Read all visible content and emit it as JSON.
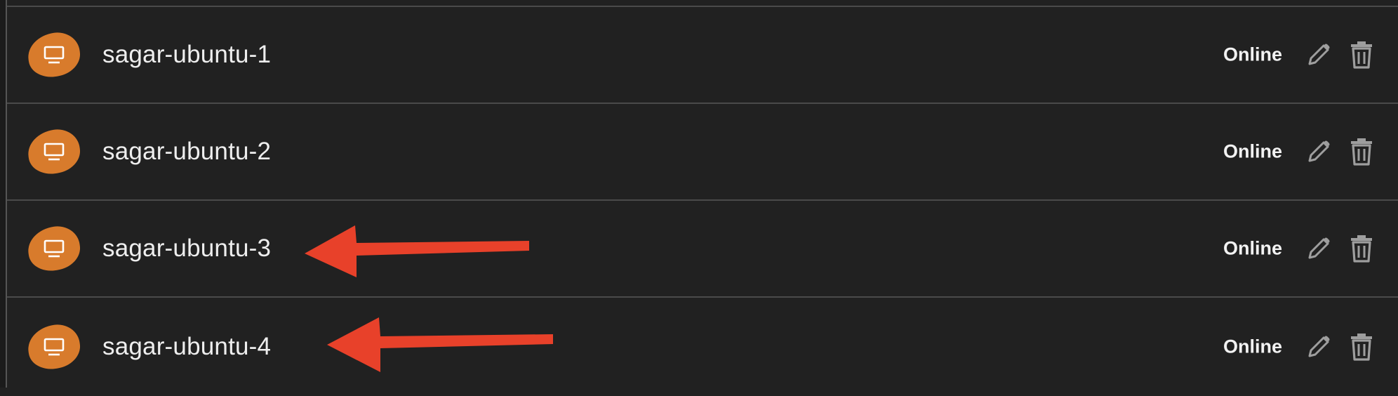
{
  "devices": [
    {
      "name": "sagar-ubuntu-1",
      "status": "Online",
      "icon": "monitor-icon",
      "annotated": false
    },
    {
      "name": "sagar-ubuntu-2",
      "status": "Online",
      "icon": "monitor-icon",
      "annotated": false
    },
    {
      "name": "sagar-ubuntu-3",
      "status": "Online",
      "icon": "monitor-icon",
      "annotated": true
    },
    {
      "name": "sagar-ubuntu-4",
      "status": "Online",
      "icon": "monitor-icon",
      "annotated": true
    }
  ],
  "actions": {
    "edit_icon": "pencil-icon",
    "delete_icon": "trash-icon"
  },
  "colors": {
    "background": "#212121",
    "avatar": "#d87b2c",
    "arrow": "#e8412a",
    "text": "#eeeeee",
    "icon": "#9e9e9e"
  }
}
